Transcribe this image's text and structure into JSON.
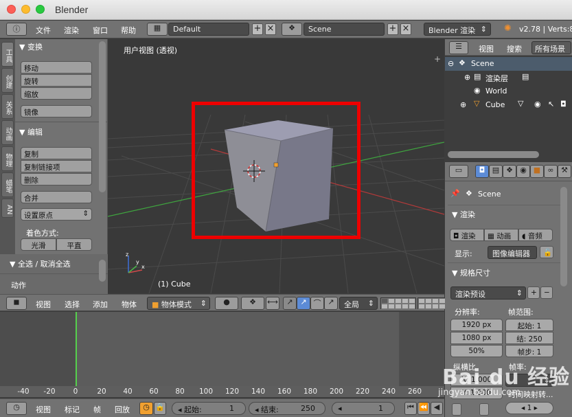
{
  "window": {
    "title": "Blender"
  },
  "topbar": {
    "menus": [
      "文件",
      "渲染",
      "窗口",
      "帮助"
    ],
    "screen_layout": "Default",
    "scene": "Scene",
    "render_engine": "Blender 渲染",
    "version_text": "v2.78 | Verts:8"
  },
  "tool_tabs": [
    "工具",
    "创建",
    "关系",
    "动画",
    "物理",
    "蜡笔",
    "AN"
  ],
  "tool_shelf": {
    "transform_header": "▼ 变换",
    "transform_buttons": [
      "移动",
      "旋转",
      "缩放"
    ],
    "mirror_button": "镜像",
    "edit_header": "▼ 编辑",
    "edit_buttons": [
      "复制",
      "复制链接项",
      "删除"
    ],
    "join_button": "合并",
    "set_origin": "设置原点",
    "shading_label": "着色方式:",
    "shading_smooth": "光滑",
    "shading_flat": "平直",
    "select_panel": "▼ 全选 / 取消全选",
    "action_label": "动作"
  },
  "viewport": {
    "view_label": "用户视图 (透视)",
    "object_label": "(1) Cube"
  },
  "view3d_header": {
    "menus": [
      "视图",
      "选择",
      "添加",
      "物体"
    ],
    "mode": "物体模式",
    "pivot_global": "全局"
  },
  "timeline": {
    "ruler": [
      "-40",
      "-20",
      "0",
      "20",
      "40",
      "60",
      "80",
      "100",
      "120",
      "140",
      "160",
      "180",
      "200",
      "220",
      "240",
      "260"
    ],
    "menus": [
      "视图",
      "标记",
      "帧",
      "回放"
    ],
    "start_label": "起始:",
    "start_value": "1",
    "end_label": "结束:",
    "end_value": "250",
    "current_frame": "1"
  },
  "outliner": {
    "header_items": [
      "视图",
      "搜索",
      "所有场景"
    ],
    "rows": [
      "Scene",
      "渲染层",
      "World",
      "Cube"
    ]
  },
  "properties": {
    "context_scene": "Scene",
    "render_panel": "▼ 渲染",
    "render_buttons": [
      "渲染",
      "动画",
      "音频"
    ],
    "display_label": "显示:",
    "display_value": "图像编辑器",
    "dimensions_panel": "▼ 规格尺寸",
    "preset": "渲染预设",
    "resolution_label": "分辨率:",
    "res_x": "1920 px",
    "res_y": "1080 px",
    "res_percent": "50%",
    "frame_range_label": "帧范围:",
    "frame_start": "起始: 1",
    "frame_end": "结: 250",
    "frame_step": "帧步: 1",
    "aspect_label": "纵横比",
    "framerate_label": "帧率:",
    "aspect_x": "X: 1.000",
    "aspect_y": "Y: 1.000",
    "time_remap": "时间映射转..."
  },
  "watermark": {
    "main": "Bai du 经验",
    "sub": "jingyan.baidu.com"
  }
}
